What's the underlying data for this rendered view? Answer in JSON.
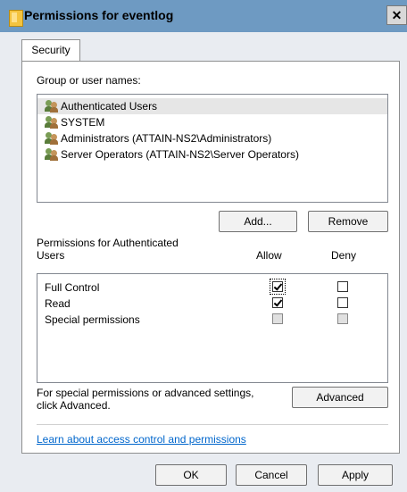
{
  "window": {
    "title": "Permissions for eventlog",
    "close_label": "✕"
  },
  "tabs": [
    {
      "label": "Security"
    }
  ],
  "group_section": {
    "label": "Group or user names:",
    "users": [
      {
        "name": "Authenticated Users",
        "selected": true
      },
      {
        "name": "SYSTEM"
      },
      {
        "name": "Administrators (ATTAIN-NS2\\Administrators)"
      },
      {
        "name": "Server Operators (ATTAIN-NS2\\Server Operators)"
      }
    ]
  },
  "buttons": {
    "add": "Add...",
    "remove": "Remove",
    "advanced": "Advanced",
    "ok": "OK",
    "cancel": "Cancel",
    "apply": "Apply"
  },
  "permissions": {
    "title_line1": "Permissions for Authenticated",
    "title_line2": "Users",
    "allow_header": "Allow",
    "deny_header": "Deny",
    "rows": [
      {
        "name": "Full Control",
        "allow": "checked",
        "deny": "unchecked"
      },
      {
        "name": "Read",
        "allow": "checked",
        "deny": "unchecked"
      },
      {
        "name": "Special permissions",
        "allow": "disabled",
        "deny": "disabled"
      }
    ]
  },
  "advanced_text": {
    "line1": "For special permissions or advanced settings,",
    "line2": "click Advanced."
  },
  "link": "Learn about access control and permissions",
  "colors": {
    "titlebar": "#6e9ac2",
    "link": "#0066cc",
    "dialog_bg": "#e9ecf1"
  }
}
